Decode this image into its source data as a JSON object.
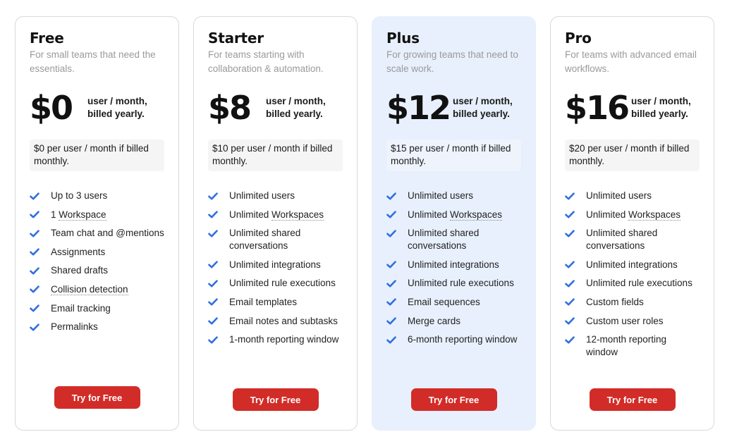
{
  "theme": {
    "accent_red": "#d22c28",
    "check_blue": "#2f6fe0",
    "highlight_bg": "#e8f0fd"
  },
  "plans": [
    {
      "name": "Free",
      "description": "For small teams that need the essentials.",
      "price": "$0",
      "price_unit_line1": "user / month,",
      "price_unit_line2": "billed yearly.",
      "monthly_note": "$0 per user / month if billed monthly.",
      "features": [
        {
          "pre": "Up to 3 users",
          "tip": ""
        },
        {
          "pre": "1 ",
          "tip": "Workspace"
        },
        {
          "pre": "Team chat and @mentions",
          "tip": ""
        },
        {
          "pre": "Assignments",
          "tip": ""
        },
        {
          "pre": "Shared drafts",
          "tip": ""
        },
        {
          "pre": "",
          "tip": "Collision detection"
        },
        {
          "pre": "Email tracking",
          "tip": ""
        },
        {
          "pre": "Permalinks",
          "tip": ""
        }
      ],
      "cta": "Try for Free",
      "highlighted": false
    },
    {
      "name": "Starter",
      "description": "For teams starting with collaboration & automation.",
      "price": "$8",
      "price_unit_line1": "user / month,",
      "price_unit_line2": "billed yearly.",
      "monthly_note": "$10 per user / month if billed monthly.",
      "features": [
        {
          "pre": "Unlimited users",
          "tip": ""
        },
        {
          "pre": "Unlimited ",
          "tip": "Workspaces"
        },
        {
          "pre": "Unlimited shared conversations",
          "tip": ""
        },
        {
          "pre": "Unlimited integrations",
          "tip": ""
        },
        {
          "pre": "Unlimited rule executions",
          "tip": ""
        },
        {
          "pre": "Email templates",
          "tip": ""
        },
        {
          "pre": "Email notes and subtasks",
          "tip": ""
        },
        {
          "pre": "1-month reporting window",
          "tip": ""
        }
      ],
      "cta": "Try for Free",
      "highlighted": false
    },
    {
      "name": "Plus",
      "description": "For growing teams that need to scale work.",
      "price": "$12",
      "price_unit_line1": "user / month,",
      "price_unit_line2": "billed yearly.",
      "monthly_note": "$15 per user / month if billed monthly.",
      "features": [
        {
          "pre": "Unlimited users",
          "tip": ""
        },
        {
          "pre": "Unlimited ",
          "tip": "Workspaces"
        },
        {
          "pre": "Unlimited shared conversations",
          "tip": ""
        },
        {
          "pre": "Unlimited integrations",
          "tip": ""
        },
        {
          "pre": "Unlimited rule executions",
          "tip": ""
        },
        {
          "pre": "Email sequences",
          "tip": ""
        },
        {
          "pre": "Merge cards",
          "tip": ""
        },
        {
          "pre": "6-month reporting window",
          "tip": ""
        }
      ],
      "cta": "Try for Free",
      "highlighted": true
    },
    {
      "name": "Pro",
      "description": "For teams with advanced email workflows.",
      "price": "$16",
      "price_unit_line1": "user / month,",
      "price_unit_line2": "billed yearly.",
      "monthly_note": "$20 per user / month if billed monthly.",
      "features": [
        {
          "pre": "Unlimited users",
          "tip": ""
        },
        {
          "pre": "Unlimited ",
          "tip": "Workspaces"
        },
        {
          "pre": "Unlimited shared conversations",
          "tip": ""
        },
        {
          "pre": "Unlimited integrations",
          "tip": ""
        },
        {
          "pre": "Unlimited rule executions",
          "tip": ""
        },
        {
          "pre": "Custom fields",
          "tip": ""
        },
        {
          "pre": "Custom user roles",
          "tip": ""
        },
        {
          "pre": "12-month reporting window",
          "tip": ""
        }
      ],
      "cta": "Try for Free",
      "highlighted": false
    }
  ]
}
